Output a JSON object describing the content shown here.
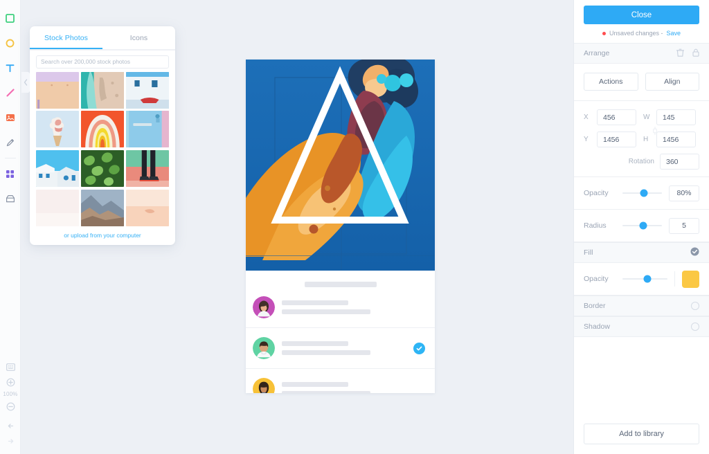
{
  "toolbar": {
    "tools": [
      {
        "name": "shape-square-tool",
        "color": "#3fd07f"
      },
      {
        "name": "shape-circle-tool",
        "color": "#f5c343"
      },
      {
        "name": "text-tool",
        "color": "#35aaf5",
        "glyph": "T"
      },
      {
        "name": "line-tool",
        "color": "#f46fb3"
      },
      {
        "name": "image-tool",
        "color": "#f4704a"
      },
      {
        "name": "pen-tool",
        "color": "#8b95a6"
      },
      {
        "name": "components-tool",
        "color": "#7b61e0"
      },
      {
        "name": "archive-tool",
        "color": "#8b95a6"
      }
    ],
    "zoom_level": "100%",
    "zoom_in_label": "zoom-in",
    "zoom_out_label": "zoom-out",
    "fit_label": "fit-to-screen"
  },
  "photo_panel": {
    "tabs": [
      {
        "label": "Stock Photos",
        "active": true
      },
      {
        "label": "Icons",
        "active": false
      }
    ],
    "search_placeholder": "Search over 200,000 stock photos",
    "search_value": "",
    "upload_link": "or upload from your computer",
    "thumbnails": [
      {
        "id": "pink-wall",
        "c1": "#d9c4e8",
        "c2": "#f0c9a8"
      },
      {
        "id": "coastline",
        "c1": "#4ec8c0",
        "c2": "#e6cdbb"
      },
      {
        "id": "blue-building",
        "c1": "#9fd0ee",
        "c2": "#eef4f8"
      },
      {
        "id": "ice-cream",
        "c1": "#cfe4f2",
        "c2": "#f3e8e2"
      },
      {
        "id": "rainbow-spiral",
        "c1": "#f2552c",
        "c2": "#f7d93b"
      },
      {
        "id": "blue-door",
        "c1": "#8ecbea",
        "c2": "#e3b7cf"
      },
      {
        "id": "white-village",
        "c1": "#61c6ef",
        "c2": "#e8eef2"
      },
      {
        "id": "green-leaves",
        "c1": "#2f6e2a",
        "c2": "#86bf5e"
      },
      {
        "id": "sneakers-court",
        "c1": "#e8877a",
        "c2": "#7fc7a8"
      },
      {
        "id": "pale-pink",
        "c1": "#f6ecec",
        "c2": "#faf5f3"
      },
      {
        "id": "canyon",
        "c1": "#8ba3b8",
        "c2": "#c2a48c"
      },
      {
        "id": "peach-minimal",
        "c1": "#f7cdb4",
        "c2": "#fae6d8"
      }
    ]
  },
  "artboard": {
    "mural_name": "blue-mural-photo",
    "triangle_name": "triangle-shape",
    "list_rows": [
      {
        "avatar": "avatar-woman-magenta",
        "bg": "#c44fb8",
        "verified": false
      },
      {
        "avatar": "avatar-man-green",
        "bg": "#5fd3a3",
        "verified": true
      },
      {
        "avatar": "avatar-woman-yellow",
        "bg": "#f7c137",
        "verified": true
      }
    ]
  },
  "right_panel": {
    "close_label": "Close",
    "unsaved_text": "Unsaved changes -",
    "save_label": "Save",
    "arrange_title": "Arrange",
    "actions_label": "Actions",
    "align_label": "Align",
    "fields": {
      "x_label": "X",
      "x_value": "456",
      "y_label": "Y",
      "y_value": "1456",
      "w_label": "W",
      "w_value": "145",
      "h_label": "H",
      "h_value": "1456",
      "rotation_label": "Rotation",
      "rotation_value": "360"
    },
    "opacity_label": "Opacity",
    "opacity_value": "80%",
    "opacity_percent": 55,
    "radius_label": "Radius",
    "radius_value": "5",
    "radius_percent": 52,
    "fill_label": "Fill",
    "fill_enabled": true,
    "fill_opacity_label": "Opacity",
    "fill_opacity_percent": 55,
    "fill_color": "#fbc844",
    "border_label": "Border",
    "border_enabled": false,
    "shadow_label": "Shadow",
    "shadow_enabled": false,
    "add_to_library_label": "Add to library",
    "accent_color": "#2eaaf5"
  }
}
